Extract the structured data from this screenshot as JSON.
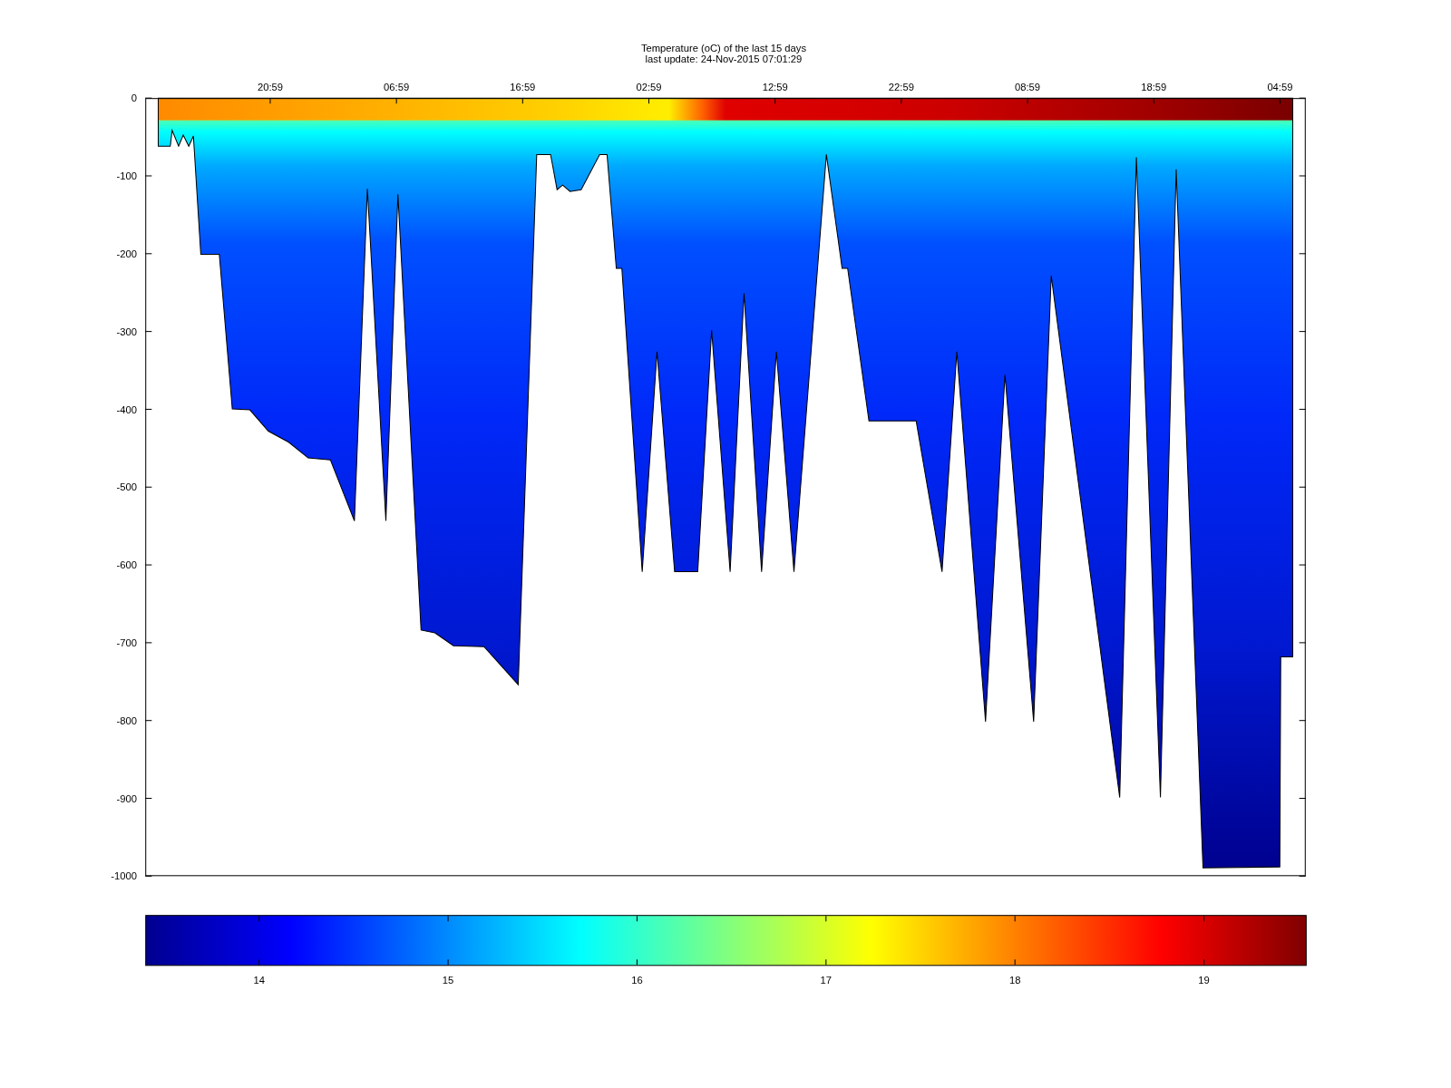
{
  "figure": {
    "title_lines": [
      "Temperature (oC) of the last 15 days",
      "last update: 24-Nov-2015 07:01:29"
    ],
    "x_tick_labels": [
      "20:59",
      "06:59",
      "16:59",
      "02:59",
      "12:59",
      "22:59",
      "08:59",
      "18:59",
      "04:59"
    ],
    "y_tick_labels": [
      "0",
      "-100",
      "-200",
      "-300",
      "-400",
      "-500",
      "-600",
      "-700",
      "-800",
      "-900",
      "-1000"
    ],
    "colorbar_tick_labels": [
      "14",
      "15",
      "16",
      "17",
      "18",
      "19"
    ]
  }
}
